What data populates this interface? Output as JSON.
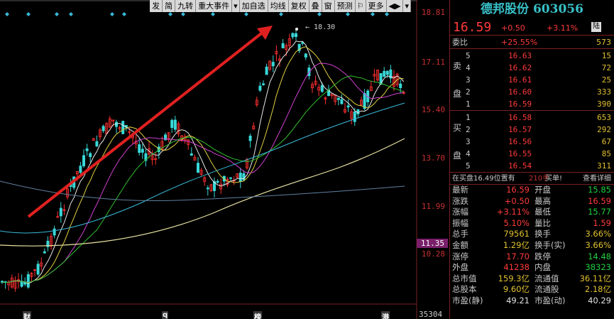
{
  "toolbar": [
    "发",
    "简",
    "九转",
    "重大事件",
    "▾",
    "加自选",
    "均线",
    "复权",
    "叠",
    "窗",
    "预测",
    "⚐",
    "更多",
    "◀▶",
    "▾"
  ],
  "price_axis": {
    "ticks": [
      "18.81",
      "17.11",
      "15.40",
      "13.70",
      "11.99",
      "10.28"
    ],
    "current": "11.35",
    "volume_max": "35304"
  },
  "chart": {
    "high_label": "18.30",
    "events": [
      "财",
      "q",
      "榜",
      "港"
    ],
    "colors": {
      "up": "#ff3030",
      "down": "#38d8d8",
      "arrow": "#e02020"
    }
  },
  "stock": {
    "name": "德邦股份",
    "code": "603056",
    "price": "16.59",
    "change": "+0.50",
    "change_pct": "+3.11%",
    "market_badge": "陆"
  },
  "ratio": {
    "label": "委比",
    "pct": "+25.55%",
    "diff": "573"
  },
  "sell_label": "卖盘",
  "buy_label": "买盘",
  "asks": [
    {
      "n": "5",
      "p": "16.63",
      "q": "15"
    },
    {
      "n": "4",
      "p": "16.62",
      "q": "72"
    },
    {
      "n": "3",
      "p": "16.61",
      "q": "25"
    },
    {
      "n": "2",
      "p": "16.60",
      "q": "333"
    },
    {
      "n": "1",
      "p": "16.59",
      "q": "390"
    }
  ],
  "bids": [
    {
      "n": "1",
      "p": "16.58",
      "q": "653"
    },
    {
      "n": "2",
      "p": "16.57",
      "q": "292"
    },
    {
      "n": "3",
      "p": "16.56",
      "q": "67"
    },
    {
      "n": "4",
      "p": "16.55",
      "q": "85"
    },
    {
      "n": "5",
      "p": "16.54",
      "q": "311"
    }
  ],
  "status": {
    "text": "在买盘16.49位置有",
    "count": "210手",
    "buy": "买单!",
    "detail": "查看详细"
  },
  "stats": [
    {
      "k1": "最新",
      "v1": "16.59",
      "c1": "red",
      "k2": "开盘",
      "v2": "15.85",
      "c2": "green"
    },
    {
      "k1": "涨跌",
      "v1": "+0.50",
      "c1": "red",
      "k2": "最高",
      "v2": "16.59",
      "c2": "red"
    },
    {
      "k1": "涨幅",
      "v1": "+3.11%",
      "c1": "red",
      "k2": "最低",
      "v2": "15.77",
      "c2": "green"
    },
    {
      "k1": "振幅",
      "v1": "5.10%",
      "c1": "red",
      "k2": "量比",
      "v2": "1.59",
      "c2": "red"
    },
    {
      "k1": "总手",
      "v1": "79561",
      "c1": "yellow",
      "k2": "换手",
      "v2": "3.66%",
      "c2": "yellow"
    },
    {
      "k1": "金额",
      "v1": "1.29亿",
      "c1": "yellow",
      "k2": "换手(实)",
      "v2": "3.66%",
      "c2": "yellow"
    },
    {
      "k1": "涨停",
      "v1": "17.70",
      "c1": "red",
      "k2": "跌停",
      "v2": "14.48",
      "c2": "green"
    },
    {
      "k1": "外盘",
      "v1": "41238",
      "c1": "red",
      "k2": "内盘",
      "v2": "38323",
      "c2": "green"
    },
    {
      "k1": "总市值",
      "v1": "159.3亿",
      "c1": "yellow",
      "k2": "流通值",
      "v2": "36.11亿",
      "c2": "yellow"
    },
    {
      "k1": "总股本",
      "v1": "9.60亿",
      "c1": "yellow",
      "k2": "流通股",
      "v2": "2.18亿",
      "c2": "yellow"
    },
    {
      "k1": "市盈(静)",
      "v1": "49.21",
      "c1": "white",
      "k2": "市盈(动)",
      "v2": "40.29",
      "c2": "white"
    }
  ]
}
